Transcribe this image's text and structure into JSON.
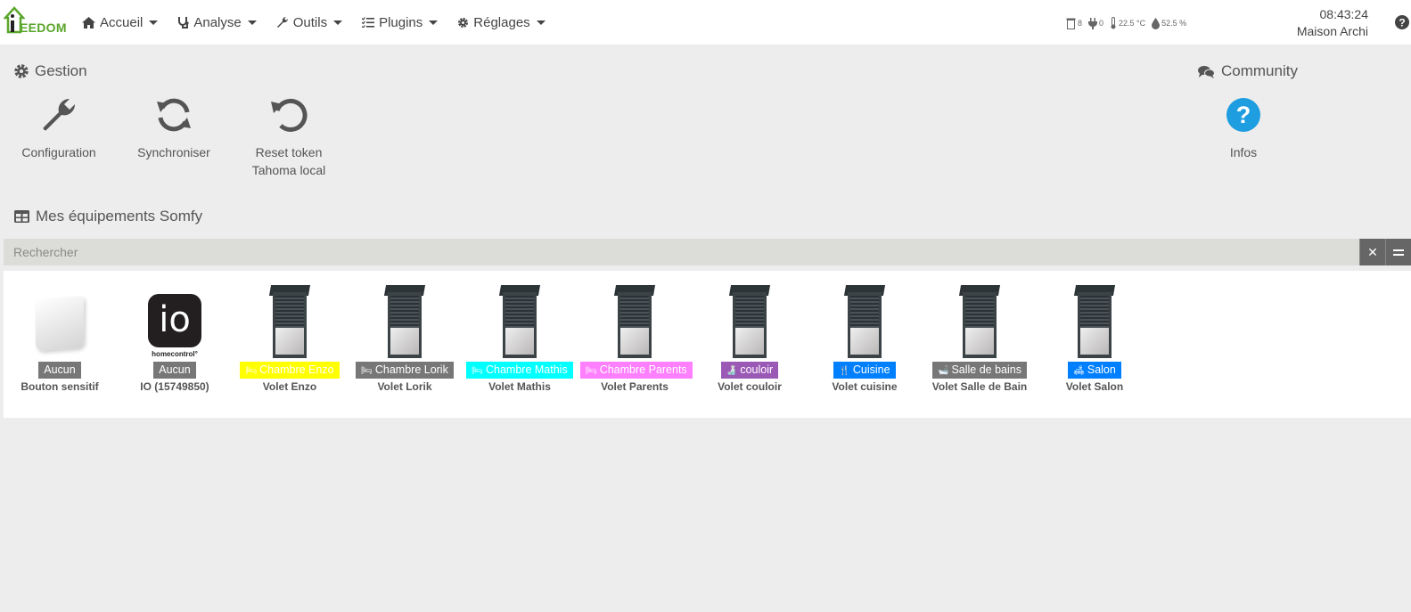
{
  "app": {
    "logo_text": "EEDOM"
  },
  "nav": {
    "items": [
      {
        "label": "Accueil",
        "icon": "home-icon"
      },
      {
        "label": "Analyse",
        "icon": "stethoscope-icon"
      },
      {
        "label": "Outils",
        "icon": "wrench-icon"
      },
      {
        "label": "Plugins",
        "icon": "tasks-icon"
      },
      {
        "label": "Réglages",
        "icon": "cogs-icon"
      }
    ]
  },
  "status": {
    "shutters": "8",
    "plugs": "0",
    "temperature": "22.5 °C",
    "humidity": "52.5 %"
  },
  "clock": {
    "time": "08:43:24",
    "location": "Maison Archi"
  },
  "gestion": {
    "title": "Gestion",
    "actions": [
      {
        "label": "Configuration",
        "icon": "wrench-icon"
      },
      {
        "label": "Synchroniser",
        "icon": "sync-icon"
      },
      {
        "label_line1": "Reset token",
        "label_line2": "Tahoma local",
        "icon": "undo-icon"
      }
    ]
  },
  "community": {
    "title": "Community",
    "info_label": "Infos",
    "info_icon": "question-circle-icon"
  },
  "equipment": {
    "title": "Mes équipements Somfy",
    "search_placeholder": "Rechercher",
    "items": [
      {
        "name": "Bouton sensitif",
        "room": "Aucun",
        "color": "#777777",
        "image": "sensor"
      },
      {
        "name": "IO (15749850)",
        "room": "Aucun",
        "color": "#777777",
        "image": "io"
      },
      {
        "name": "Volet Enzo",
        "room": "Chambre Enzo",
        "color": "#ffff00",
        "image": "shutter"
      },
      {
        "name": "Volet Lorik",
        "room": "Chambre Lorik",
        "color": "#777777",
        "image": "shutter"
      },
      {
        "name": "Volet Mathis",
        "room": "Chambre Mathis",
        "color": "#00ffff",
        "image": "shutter"
      },
      {
        "name": "Volet Parents",
        "room": "Chambre Parents",
        "color": "#ff80ff",
        "image": "shutter"
      },
      {
        "name": "Volet couloir",
        "room": "couloir",
        "color": "#9b59b6",
        "image": "shutter"
      },
      {
        "name": "Volet cuisine",
        "room": "Cuisine",
        "color": "#0080ff",
        "image": "shutter"
      },
      {
        "name": "Volet Salle de Bain",
        "room": "Salle de bains",
        "color": "#777777",
        "image": "shutter"
      },
      {
        "name": "Volet Salon",
        "room": "Salon",
        "color": "#0080ff",
        "image": "shutter"
      }
    ]
  }
}
